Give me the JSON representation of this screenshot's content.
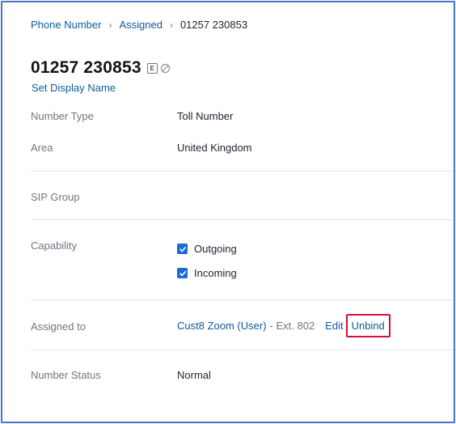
{
  "breadcrumb": {
    "items": [
      "Phone Number",
      "Assigned"
    ],
    "separator": "›",
    "current": "01257 230853"
  },
  "header": {
    "title": "01257 230853",
    "badge": "E",
    "set_display_name": "Set Display Name"
  },
  "details": {
    "number_type": {
      "label": "Number Type",
      "value": "Toll Number"
    },
    "area": {
      "label": "Area",
      "value": "United Kingdom"
    },
    "sip_group": {
      "label": "SIP Group",
      "value": ""
    },
    "capability": {
      "label": "Capability",
      "options": [
        {
          "label": "Outgoing",
          "checked": true
        },
        {
          "label": "Incoming",
          "checked": true
        }
      ]
    },
    "assigned_to": {
      "label": "Assigned to",
      "assignee": "Cust8 Zoom (User)",
      "extension": "- Ext. 802",
      "edit_label": "Edit",
      "unbind_label": "Unbind"
    },
    "number_status": {
      "label": "Number Status",
      "value": "Normal"
    }
  },
  "colors": {
    "link": "#0e5a9e",
    "checkbox": "#1a6bd4",
    "highlight_box": "#d0103a",
    "frame_border": "#4a74c4"
  }
}
